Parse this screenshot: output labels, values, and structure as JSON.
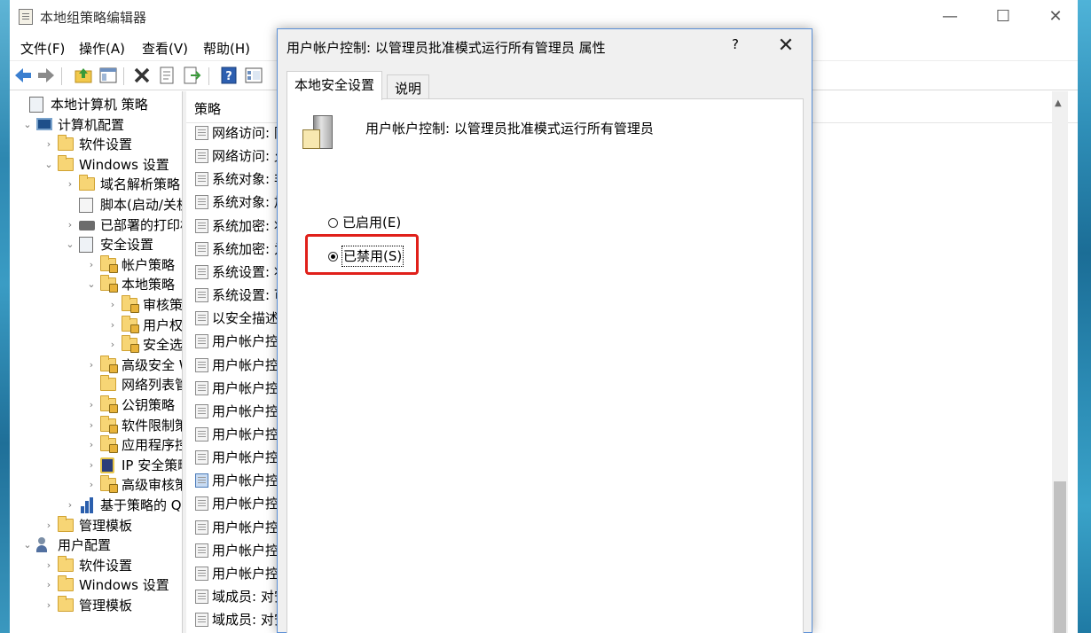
{
  "window": {
    "title": "本地组策略编辑器",
    "minimize": "—",
    "maximize": "☐",
    "close": "✕"
  },
  "menu": [
    "文件(F)",
    "操作(A)",
    "查看(V)",
    "帮助(H)"
  ],
  "toolbar_icons": [
    "back-icon",
    "forward-icon",
    "up-folder-icon",
    "show-hide-tree-icon",
    "delete-icon",
    "properties-icon",
    "export-icon",
    "help-icon",
    "view-icon"
  ],
  "tree": [
    {
      "label": "本地计算机 策略",
      "icon": "policy-doc-icon",
      "toggle": ""
    },
    {
      "label": "计算机配置",
      "icon": "computer-icon",
      "toggle": "⌄"
    },
    {
      "label": "软件设置",
      "icon": "folder-icon",
      "toggle": "›"
    },
    {
      "label": "Windows 设置",
      "icon": "folder-icon",
      "toggle": "⌄"
    },
    {
      "label": "域名解析策略",
      "icon": "folder-icon",
      "toggle": "›"
    },
    {
      "label": "脚本(启动/关机)",
      "icon": "script-icon",
      "toggle": ""
    },
    {
      "label": "已部署的打印机",
      "icon": "printer-icon",
      "toggle": "›"
    },
    {
      "label": "安全设置",
      "icon": "security-settings-icon",
      "toggle": "⌄"
    },
    {
      "label": "帐户策略",
      "icon": "locked-folder-icon",
      "toggle": "›"
    },
    {
      "label": "本地策略",
      "icon": "locked-folder-icon",
      "toggle": "⌄"
    },
    {
      "label": "审核策略",
      "icon": "locked-folder-icon",
      "toggle": "›"
    },
    {
      "label": "用户权限分配",
      "icon": "locked-folder-icon",
      "toggle": "›"
    },
    {
      "label": "安全选项",
      "icon": "locked-folder-icon",
      "toggle": "›"
    },
    {
      "label": "高级安全 Windows Defender 防火墙",
      "icon": "locked-folder-icon",
      "toggle": "›"
    },
    {
      "label": "网络列表管理器策略",
      "icon": "folder-icon",
      "toggle": ""
    },
    {
      "label": "公钥策略",
      "icon": "locked-folder-icon",
      "toggle": "›"
    },
    {
      "label": "软件限制策略",
      "icon": "locked-folder-icon",
      "toggle": "›"
    },
    {
      "label": "应用程序控制策略",
      "icon": "locked-folder-icon",
      "toggle": "›"
    },
    {
      "label": "IP 安全策略",
      "icon": "ip-security-icon",
      "toggle": "›"
    },
    {
      "label": "高级审核策略配置",
      "icon": "locked-folder-icon",
      "toggle": "›"
    },
    {
      "label": "基于策略的 QoS",
      "icon": "chart-icon",
      "toggle": "›"
    },
    {
      "label": "管理模板",
      "icon": "folder-icon",
      "toggle": "›"
    },
    {
      "label": "用户配置",
      "icon": "user-icon",
      "toggle": "⌄"
    },
    {
      "label": "软件设置",
      "icon": "folder-icon",
      "toggle": "›"
    },
    {
      "label": "Windows 设置",
      "icon": "folder-icon",
      "toggle": "›"
    },
    {
      "label": "管理模板",
      "icon": "folder-icon",
      "toggle": "›"
    }
  ],
  "list": {
    "header": "策略",
    "items": [
      "网络访问: 限",
      "网络访问: 允",
      "系统对象: 非",
      "系统对象: 加",
      "系统加密: 将",
      "系统加密: 为",
      "系统设置: 将",
      "系统设置: 可",
      "以安全描述",
      "用户帐户控",
      "用户帐户控",
      "用户帐户控",
      "用户帐户控",
      "用户帐户控",
      "用户帐户控",
      "用户帐户控",
      "用户帐户控",
      "用户帐户控",
      "用户帐户控",
      "用户帐户控",
      "域成员: 对安",
      "域成员: 对安",
      "域成员: 对安"
    ],
    "selected_index": 15
  },
  "dialog": {
    "title": "用户帐户控制: 以管理员批准模式运行所有管理员 属性",
    "help": "?",
    "close": "✕",
    "tabs": [
      "本地安全设置",
      "说明"
    ],
    "active_tab": 0,
    "policy_name": "用户帐户控制: 以管理员批准模式运行所有管理员",
    "options": [
      {
        "label": "已启用(E)",
        "checked": false
      },
      {
        "label": "已禁用(S)",
        "checked": true
      }
    ],
    "highlight_color": "#e0201a"
  }
}
